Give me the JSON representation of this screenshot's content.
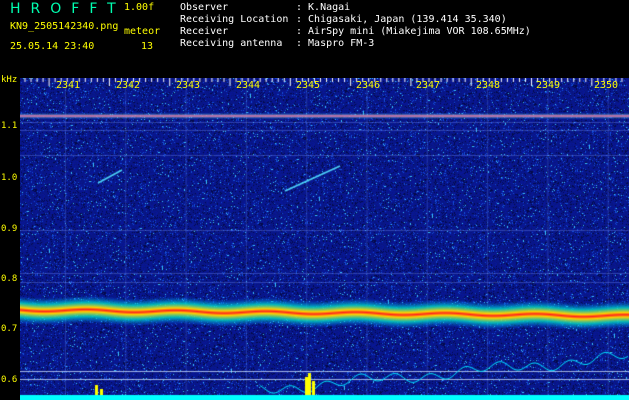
{
  "header": {
    "logo": "HROFFT",
    "version": "1.00f",
    "filename": "KN9_2505142340.png",
    "datetime": "25.05.14 23:40",
    "meteor_label": "meteor",
    "meteor_count": "13",
    "info": [
      {
        "label": "Observer",
        "value": ": K.Nagai"
      },
      {
        "label": "Receiving Location",
        "value": ": Chigasaki, Japan (139.414 35.340)"
      },
      {
        "label": "Receiver",
        "value": ": AirSpy mini (Miakejima VOR 108.65MHz)"
      },
      {
        "label": "Receiving antenna",
        "value": ": Maspro FM-3"
      }
    ]
  },
  "axis": {
    "y_unit": "kHz",
    "y_ticks": [
      "1.1",
      "1.0",
      "0.9",
      "0.8",
      "0.7",
      "0.6"
    ],
    "x_ticks": [
      "2341",
      "2342",
      "2343",
      "2344",
      "2345",
      "2346",
      "2347",
      "2348",
      "2349",
      "2350"
    ]
  },
  "colors": {
    "background": "#000000",
    "text": "#ffff00",
    "text_info": "#ffffff",
    "spectrogram_base": "#0a1a8c",
    "band_core": "#ff2020",
    "signal_line": "#00e0ff"
  }
}
